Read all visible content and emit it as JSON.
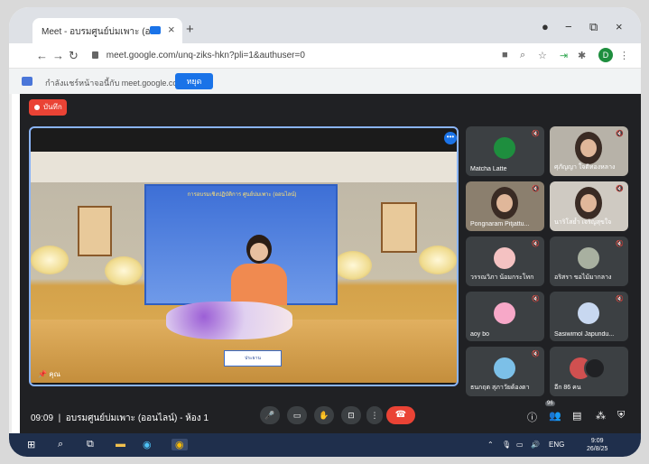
{
  "browser": {
    "tab_title": "Meet - อบรมศูนย์บ่มเพาะ (ออ",
    "tab_close": "×",
    "new_tab": "+",
    "minimize": "−",
    "restore": "⧉",
    "close": "×",
    "url": "meet.google.com/unq-ziks-hkn?pli=1&authuser=0",
    "profile_initial": "D"
  },
  "infobar": {
    "text": "กำลังแชร์หน้าจอนี้กับ meet.google.com",
    "button": "หยุด"
  },
  "meeting": {
    "recording_label": "บันทึก",
    "self_name": "คุณ",
    "banner_text": "การอบรมเชิงปฏิบัติการ ศูนย์บ่มเพาะ (ออนไลน์)",
    "nameplate_text": "ประธาน",
    "time": "09:09",
    "title": "อบรมศูนย์บ่มเพาะ (ออนไลน์) - ห้อง 1",
    "participant_count": "96"
  },
  "participants": [
    {
      "name": "Matcha Latte",
      "muted": true,
      "camera": false,
      "avatar_color": "#1e8e3e"
    },
    {
      "name": "ศุภัญญา ใจดีทองหลาง",
      "muted": true,
      "camera": true
    },
    {
      "name": "Pongnaram Pitjattu...",
      "muted": true,
      "camera": true
    },
    {
      "name": "นาริโสย้ำ เจริญสุขใจ",
      "muted": true,
      "camera": true
    },
    {
      "name": "วรรณวิภา น้อมกระโทก",
      "muted": true,
      "camera": false,
      "avatar_color": "#f4c2c2"
    },
    {
      "name": "อริสรา ขอไม้มากลาง",
      "muted": true,
      "camera": false,
      "avatar_color": "#a8b0a0"
    },
    {
      "name": "aoy bo",
      "muted": true,
      "camera": false,
      "avatar_color": "#f7a8c8"
    },
    {
      "name": "Sasiwimol Japundu...",
      "muted": true,
      "camera": false,
      "avatar_color": "#c8d8f0"
    },
    {
      "name": "ธนกฤต สุภาวัยด้องตา",
      "muted": true,
      "camera": false,
      "avatar_color": "#7cc0e8"
    },
    {
      "name": "อีก 86 คน",
      "muted": false,
      "camera": false,
      "avatar_color": "#d05050"
    }
  ],
  "taskbar": {
    "language": "ENG",
    "clock_time": "9:09",
    "clock_date": "26/8/25"
  }
}
